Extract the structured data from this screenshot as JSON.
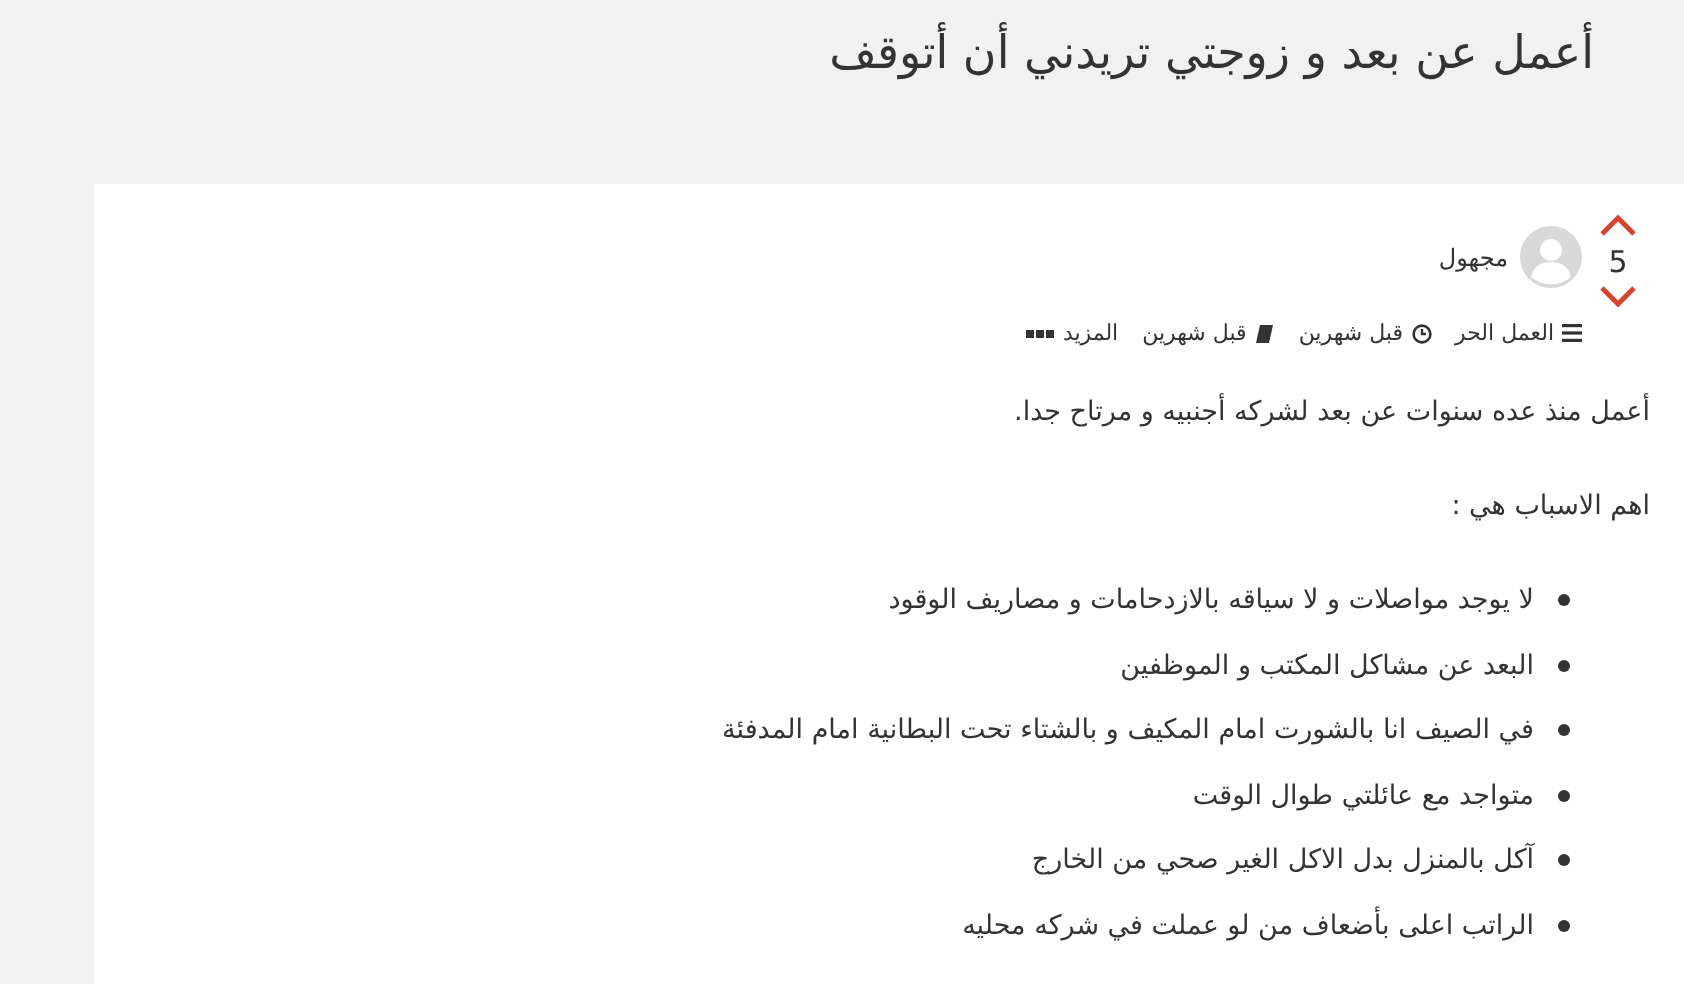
{
  "title": "أعمل عن بعد و زوجتي تريدني أن أتوقف",
  "vote": {
    "count": "5"
  },
  "author": {
    "name": "مجهول"
  },
  "meta": [
    {
      "kind": "category",
      "label": "العمل الحر"
    },
    {
      "kind": "time",
      "label": "قبل شهرين"
    },
    {
      "kind": "activity",
      "label": "قبل شهرين"
    },
    {
      "kind": "more",
      "label": "المزيد"
    }
  ],
  "body": {
    "paragraphs": [
      "أعمل منذ عده سنوات عن بعد لشركه أجنبيه و مرتاح جدا.",
      "اهم الاسباب هي :"
    ],
    "bullets": [
      "لا يوجد مواصلات و لا سياقه بالازدحامات و مصاريف الوقود",
      "البعد عن مشاكل المكتب و الموظفين",
      "في الصيف انا بالشورت امام المكيف و بالشتاء تحت البطانية امام المدفئة",
      "متواجد مع عائلتي طوال الوقت",
      "آكل بالمنزل بدل الاكل الغير صحي من الخارج",
      "الراتب اعلى بأضعاف من لو عملت في شركه محليه"
    ]
  }
}
